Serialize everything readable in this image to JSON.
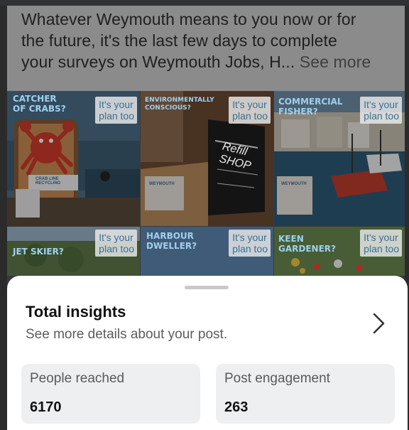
{
  "post": {
    "caption_line1": "Whatever Weymouth means to you now or for",
    "caption_line2": "the future, it's the last few days to complete",
    "caption_line3": "your surveys on Weymouth Jobs, H...",
    "see_more": "See more"
  },
  "grid": {
    "tiles": [
      {
        "tag_line1": "CATCHER",
        "tag_line2": "OF CRABS?",
        "badge_line1": "It's your",
        "badge_line2": "plan too",
        "extra1": "CRAB LINE",
        "extra2": "RECYCLING"
      },
      {
        "tag_line1": "ENVIRONMENTALLY",
        "tag_line2": "CONSCIOUS?",
        "badge_line1": "It's your",
        "badge_line2": "plan too",
        "extra1": "Refill SHOP",
        "extra2": "WEYMOUTH"
      },
      {
        "tag_line1": "COMMERCIAL",
        "tag_line2": "FISHER?",
        "badge_line1": "It's your",
        "badge_line2": "plan too",
        "extra1": "WEYMOUTH",
        "extra2": ""
      },
      {
        "tag_line1": "JET SKIER?",
        "tag_line2": "",
        "badge_line1": "It's your",
        "badge_line2": "plan too"
      },
      {
        "tag_line1": "HARBOUR",
        "tag_line2": "DWELLER?",
        "badge_line1": "It's your",
        "badge_line2": "plan too"
      },
      {
        "tag_line1": "KEEN",
        "tag_line2": "GARDENER?",
        "badge_line1": "It's your",
        "badge_line2": "plan too"
      }
    ]
  },
  "insights": {
    "title": "Total insights",
    "subtitle": "See more details about your post.",
    "cards": [
      {
        "label": "People reached",
        "value": "6170"
      },
      {
        "label": "Post engagement",
        "value": "263"
      }
    ]
  },
  "colors": {
    "tag": "#9fd0ee",
    "badge_text": "#3a6f94",
    "sheet_bg": "#ffffff",
    "card_bg": "#eeeff1"
  },
  "icons": {
    "chevron": "chevron-right-icon"
  }
}
